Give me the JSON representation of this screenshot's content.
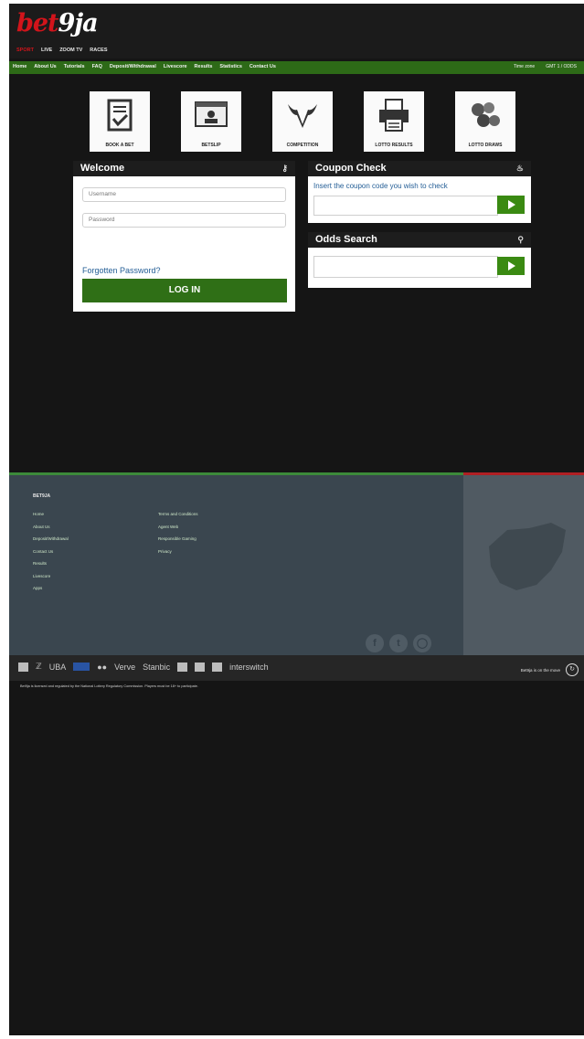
{
  "brand": {
    "logo_text_1": "bet",
    "logo_text_2": "9ja"
  },
  "top_nav": [
    "SPORT",
    "LIVE",
    "ZOOM TV",
    "RACES"
  ],
  "main_nav": [
    "Home",
    "About Us",
    "Tutorials",
    "FAQ",
    "Deposit/Withdrawal",
    "Livescore",
    "Results",
    "Statistics",
    "Contact Us"
  ],
  "main_nav_right": [
    "Time zone",
    "GMT 1 / ODDS"
  ],
  "quick_links": [
    {
      "label": "BOOK A BET",
      "icon": "clipboard-check-icon"
    },
    {
      "label": "BETSLIP",
      "icon": "account-icon"
    },
    {
      "label": "COMPETITION",
      "icon": "bull-icon"
    },
    {
      "label": "LOTTO RESULTS",
      "icon": "printer-icon"
    },
    {
      "label": "LOTTO DRAWS",
      "icon": "lotto-balls-icon"
    }
  ],
  "login": {
    "title": "Welcome",
    "username_placeholder": "Username",
    "password_placeholder": "Password",
    "forgot_label": "Forgotten Password?",
    "button_label": "LOG IN"
  },
  "coupon": {
    "title": "Coupon Check",
    "instruction": "Insert the coupon code you wish to check"
  },
  "odds_search": {
    "title": "Odds Search"
  },
  "footer": {
    "heading": "BET9JA",
    "col1": [
      "Home",
      "About Us",
      "Deposit/Withdrawal",
      "Contact Us",
      "Results",
      "Livescore",
      "Apps"
    ],
    "col2": [
      "Terms and Conditions",
      "Agent Web",
      "Responsible Gaming",
      "Privacy"
    ]
  },
  "payments": {
    "text_1": "UBA",
    "text_2": "VISA",
    "text_3": "Verve",
    "text_4": "Stanbic",
    "text_5": "interswitch",
    "right_text": "Bet9ja is on the move"
  },
  "disclaimer": "Bet9ja is licensed and regulated by the National Lottery Regulatory Commission. Players must be 18+ to participate."
}
